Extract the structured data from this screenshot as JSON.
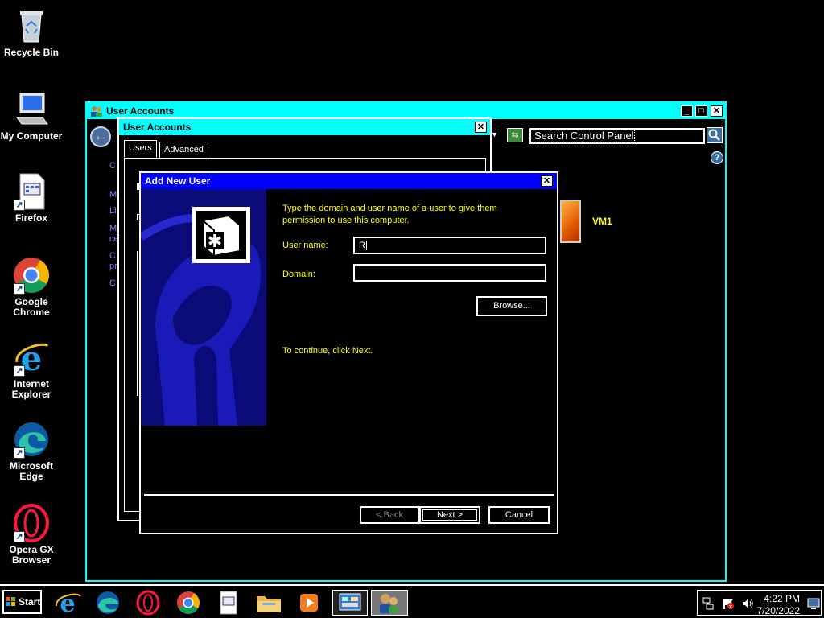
{
  "desktop": {
    "icons": [
      {
        "label": "Recycle Bin"
      },
      {
        "label": "My Computer"
      },
      {
        "label": "Firefox"
      },
      {
        "label": "Google Chrome"
      },
      {
        "label": "Internet Explorer"
      },
      {
        "label": "Microsoft Edge"
      },
      {
        "label": "Opera GX Browser"
      }
    ]
  },
  "control_panel_window": {
    "title": "User Accounts",
    "search_value": "Search Control Panel",
    "left_fragments": [
      "C",
      "M",
      "Li",
      "M",
      "ce",
      "C",
      "pr",
      "C"
    ],
    "vm_label": "VM1"
  },
  "user_accounts_dialog": {
    "title": "User Accounts",
    "tabs": [
      "Users",
      "Advanced"
    ]
  },
  "add_user_wizard": {
    "title": "Add New User",
    "intro": "Type the domain and user name of a user to give them permission to use this computer.",
    "username_label": "User name:",
    "username_value": "R",
    "domain_label": "Domain:",
    "domain_value": "",
    "browse_label": "Browse...",
    "continue_text": "To continue, click Next.",
    "back_label": "< Back",
    "next_label": "Next >",
    "cancel_label": "Cancel"
  },
  "taskbar": {
    "start_label": "Start",
    "time": "4:22 PM",
    "date": "7/20/2022"
  },
  "colors": {
    "title_active": "#0000ff",
    "title_inactive": "#00ffff",
    "wizard_text": "#ffff00"
  }
}
